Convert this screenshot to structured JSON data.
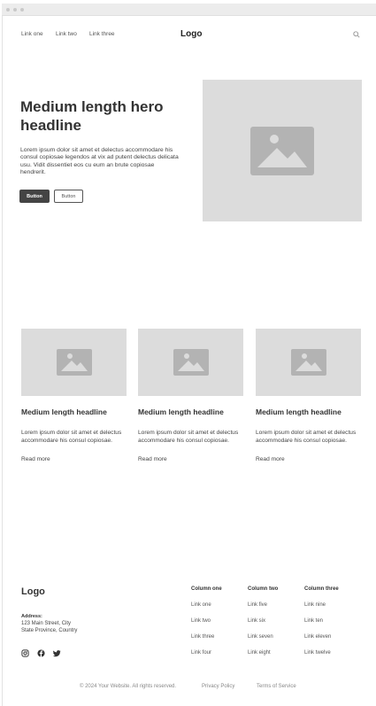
{
  "nav": {
    "links": [
      "Link one",
      "Link two",
      "Link three"
    ],
    "logo": "Logo"
  },
  "hero": {
    "title": "Medium length hero headline",
    "text": "Lorem ipsum dolor sit amet et delectus accommodare his consul copiosae legendos at vix ad putent delectus delicata usu. Vidit dissentiet eos cu eum an brute copiosae hendrerit.",
    "primary_button": "Button",
    "secondary_button": "Button"
  },
  "cards": [
    {
      "title": "Medium length headline",
      "text": "Lorem ipsum dolor sit amet et delectus accommodare his consul copiosae.",
      "link": "Read more"
    },
    {
      "title": "Medium length headline",
      "text": "Lorem ipsum dolor sit amet et delectus accommodare his consul copiosae.",
      "link": "Read more"
    },
    {
      "title": "Medium length headline",
      "text": "Lorem ipsum dolor sit amet et delectus accommodare his consul copiosae.",
      "link": "Read more"
    }
  ],
  "footer": {
    "logo": "Logo",
    "address_label": "Address:",
    "address_line1": "123 Main Street, City",
    "address_line2": "State Province, Country",
    "social_icons": [
      "instagram-icon",
      "facebook-icon",
      "twitter-icon"
    ],
    "columns": [
      {
        "heading": "Column one",
        "links": [
          "Link one",
          "Link two",
          "Link three",
          "Link four"
        ]
      },
      {
        "heading": "Column two",
        "links": [
          "Link five",
          "Link six",
          "Link seven",
          "Link eight"
        ]
      },
      {
        "heading": "Column three",
        "links": [
          "Link nine",
          "Link ten",
          "Link eleven",
          "Link twelve"
        ]
      }
    ],
    "copyright": "© 2024 Your Website. All rights reserved.",
    "privacy": "Privacy Policy",
    "terms": "Terms of Service"
  },
  "colors": {
    "placeholder": "#dcdcdc",
    "placeholder_icon": "#b3b3b3",
    "primary_button": "#444444"
  }
}
